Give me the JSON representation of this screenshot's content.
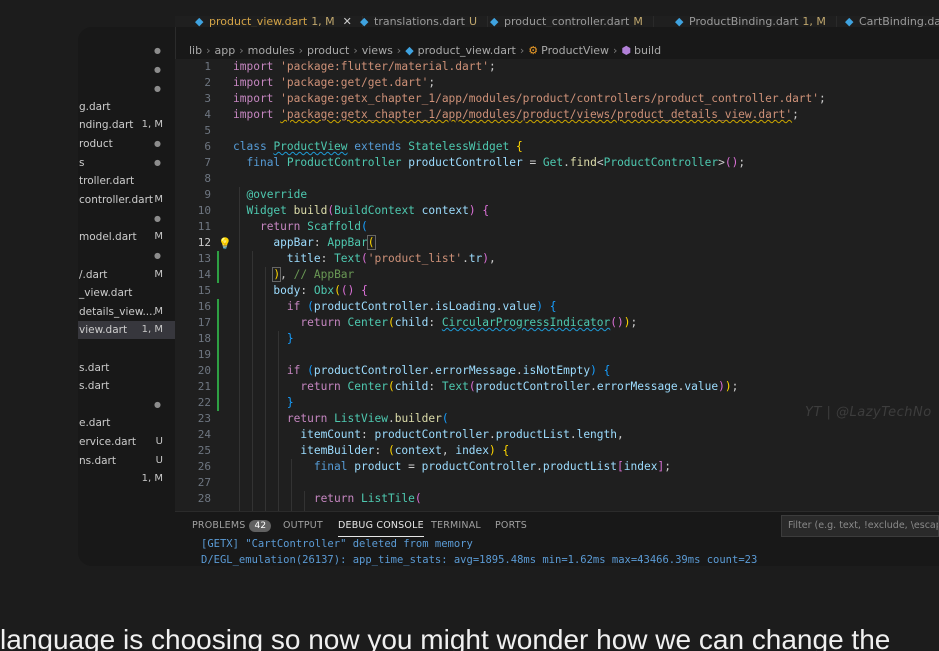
{
  "tabs": [
    {
      "name": "product_view.dart",
      "status": "1, M",
      "active": true
    },
    {
      "name": "translations.dart",
      "status": "U"
    },
    {
      "name": "product_controller.dart",
      "status": "M"
    },
    {
      "name": "ProductBinding.dart",
      "status": "1, M"
    },
    {
      "name": "CartBinding.dart",
      "status": ""
    }
  ],
  "tab_close_glyph": "✕",
  "explorer": {
    "files": [
      {
        "name": "",
        "status": "●",
        "kind": "greydot"
      },
      {
        "name": "",
        "status": "●",
        "kind": "greydot"
      },
      {
        "name": "",
        "status": "●",
        "kind": "greydot"
      },
      {
        "name": "g.dart",
        "status": ""
      },
      {
        "name": "nding.dart",
        "status": "1, M"
      },
      {
        "name": "roduct",
        "status": "●",
        "kind": "greydot"
      },
      {
        "name": "s",
        "status": "●",
        "kind": "greydot"
      },
      {
        "name": "troller.dart",
        "status": ""
      },
      {
        "name": "controller.dart",
        "status": "M"
      },
      {
        "name": "",
        "status": "●",
        "kind": "greydot"
      },
      {
        "name": "model.dart",
        "status": "M"
      },
      {
        "name": "",
        "status": "●",
        "kind": "greydot"
      },
      {
        "name": "/.dart",
        "status": "M"
      },
      {
        "name": "_view.dart",
        "status": ""
      },
      {
        "name": "details_view....",
        "status": "M"
      },
      {
        "name": "view.dart",
        "status": "1, M",
        "selected": true
      },
      {
        "name": "",
        "status": ""
      },
      {
        "name": "s.dart",
        "status": ""
      },
      {
        "name": "s.dart",
        "status": ""
      },
      {
        "name": "",
        "status": "●",
        "kind": "greydot"
      },
      {
        "name": "e.dart",
        "status": ""
      },
      {
        "name": "ervice.dart",
        "status": "U"
      },
      {
        "name": "ns.dart",
        "status": "U"
      },
      {
        "name": "",
        "status": "1, M"
      }
    ]
  },
  "breadcrumb": {
    "parts": [
      "lib",
      "app",
      "modules",
      "product",
      "views"
    ],
    "file": "product_view.dart",
    "class": "ProductView",
    "method": "build"
  },
  "code": {
    "line_numbers": [
      "1",
      "2",
      "3",
      "4",
      "5",
      "6",
      "7",
      "8",
      "9",
      "10",
      "11",
      "12",
      "13",
      "14",
      "15",
      "16",
      "17",
      "18",
      "19",
      "20",
      "21",
      "22",
      "23",
      "24",
      "25",
      "26",
      "27",
      "28"
    ],
    "current_line": "12"
  },
  "watermark": "YT | @LazyTechNo",
  "panel": {
    "tabs": [
      "PROBLEMS",
      "OUTPUT",
      "DEBUG CONSOLE",
      "TERMINAL",
      "PORTS"
    ],
    "problems_count": "42",
    "active_tab": "DEBUG CONSOLE",
    "filter_placeholder": "Filter (e.g. text, !exclude, \\escape)",
    "console_lines": [
      "[GETX] \"CartController\" deleted from memory",
      "D/EGL_emulation(26137): app_time_stats: avg=1895.48ms min=1.62ms max=43466.39ms count=23"
    ]
  },
  "caption": "language is choosing so now you might wonder how we can change the"
}
